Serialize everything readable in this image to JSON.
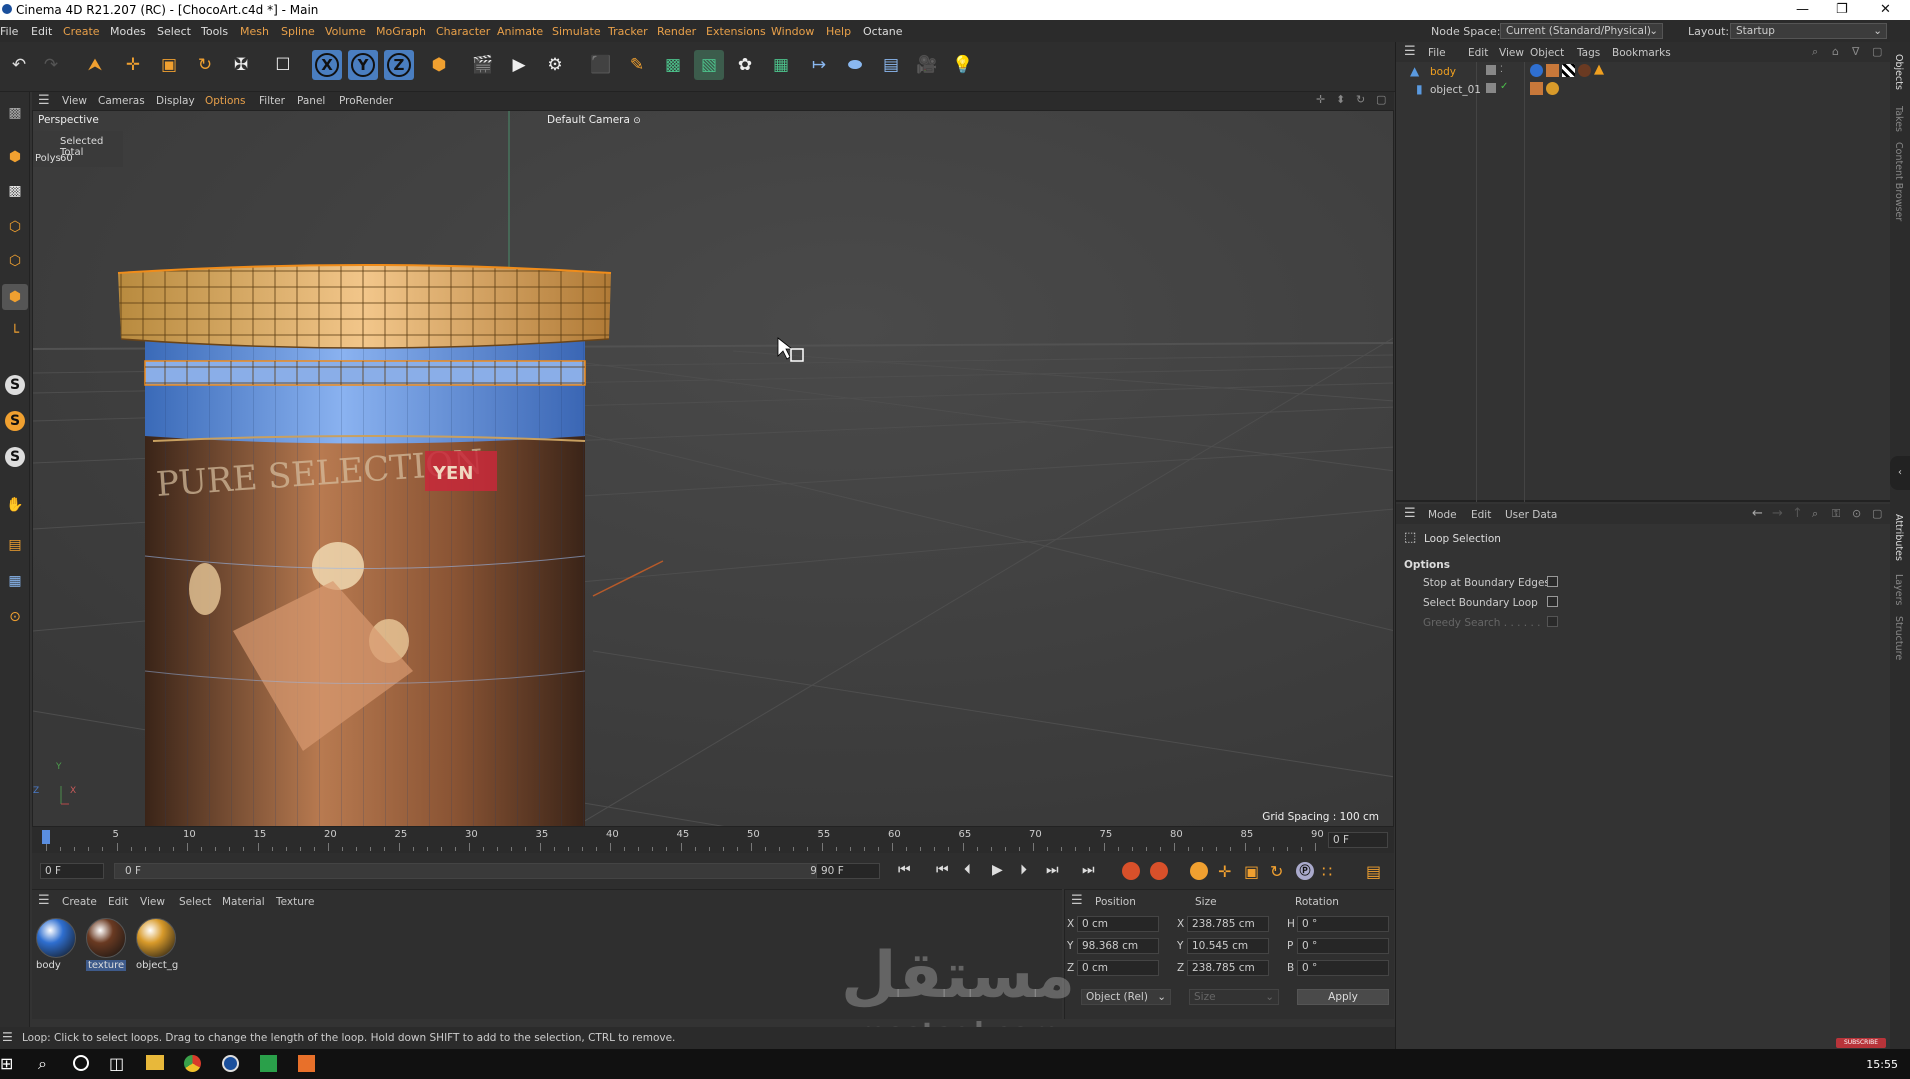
{
  "window": {
    "title": "Cinema 4D R21.207 (RC) - [ChocoArt.c4d *] - Main"
  },
  "menu": [
    "File",
    "Edit",
    "Create",
    "Modes",
    "Select",
    "Tools",
    "Mesh",
    "Spline",
    "Volume",
    "MoGraph",
    "Character",
    "Animate",
    "Simulate",
    "Tracker",
    "Render",
    "Extensions",
    "Window",
    "Help",
    "Octane"
  ],
  "header": {
    "node_space_label": "Node Space:",
    "node_space_value": "Current (Standard/Physical)",
    "layout_label": "Layout:",
    "layout_value": "Startup"
  },
  "toolbar": {
    "axis_x": "X",
    "axis_y": "Y",
    "axis_z": "Z"
  },
  "left_tools": {
    "s1": "S",
    "s2": "S",
    "s3": "S"
  },
  "viewport_menu": [
    "View",
    "Cameras",
    "Display",
    "Options",
    "Filter",
    "Panel",
    "ProRender"
  ],
  "viewport": {
    "name": "Perspective",
    "camera": "Default Camera",
    "stats_header": "Selected Total",
    "stats_label": "Polys",
    "stats_value": "60",
    "grid_spacing": "Grid Spacing : 100 cm",
    "axis_y": "Y",
    "axis_z": "Z",
    "axis_x": "X",
    "label_text": "PURE SELECTION",
    "label_badge": "YEN"
  },
  "timeline": {
    "ticks": [
      "0",
      "5",
      "10",
      "15",
      "20",
      "25",
      "30",
      "35",
      "40",
      "45",
      "50",
      "55",
      "60",
      "65",
      "70",
      "75",
      "80",
      "85",
      "90"
    ],
    "current_frame": "0 F"
  },
  "transport": {
    "start_field": "0 F",
    "range_start": "0 F",
    "range_end": "90 F",
    "end_field": "90 F"
  },
  "material_manager": {
    "menu": [
      "Create",
      "Edit",
      "View",
      "Select",
      "Material",
      "Texture"
    ],
    "materials": [
      {
        "name": "body",
        "color": "#2f6fd0"
      },
      {
        "name": "texture",
        "color": "#6a3a22"
      },
      {
        "name": "object_g",
        "color": "#d89a2a"
      }
    ]
  },
  "coordinates": {
    "headers": {
      "position": "Position",
      "size": "Size",
      "rotation": "Rotation"
    },
    "rows": [
      {
        "axis": "X",
        "pos": "0 cm",
        "size_axis": "X",
        "size": "238.785 cm",
        "rot_axis": "H",
        "rot": "0 °"
      },
      {
        "axis": "Y",
        "pos": "98.368 cm",
        "size_axis": "Y",
        "size": "10.545 cm",
        "rot_axis": "P",
        "rot": "0 °"
      },
      {
        "axis": "Z",
        "pos": "0 cm",
        "size_axis": "Z",
        "size": "238.785 cm",
        "rot_axis": "B",
        "rot": "0 °"
      }
    ],
    "mode": "Object (Rel)",
    "size_mode": "Size",
    "apply": "Apply"
  },
  "status": "Loop: Click to select loops. Drag to change the length of the loop. Hold down SHIFT to add to the selection, CTRL to remove.",
  "object_manager": {
    "menu": [
      "File",
      "Edit",
      "View",
      "Object",
      "Tags",
      "Bookmarks"
    ],
    "objects": [
      {
        "name": "body",
        "selected": true
      },
      {
        "name": "object_01",
        "selected": false
      }
    ]
  },
  "attributes": {
    "menu": [
      "Mode",
      "Edit",
      "User Data"
    ],
    "tool": "Loop Selection",
    "section": "Options",
    "options": [
      {
        "label": "Stop at Boundary Edges",
        "enabled": true
      },
      {
        "label": "Select Boundary Loop",
        "enabled": true
      },
      {
        "label": "Greedy Search . . . . . .",
        "enabled": false
      }
    ]
  },
  "vertical_tabs": [
    "Objects",
    "Takes",
    "Content Browser",
    "Attributes",
    "Layers",
    "Structure"
  ],
  "watermark": {
    "arabic": "مستقل",
    "latin": "mostaql.com",
    "subscribe": "SUBSCRIBE"
  },
  "taskbar": {
    "time": "15:55"
  },
  "colors": {
    "accent": "#4a8fe8",
    "selection_orange": "#f08c1a",
    "object_selected": "#f0a020"
  }
}
